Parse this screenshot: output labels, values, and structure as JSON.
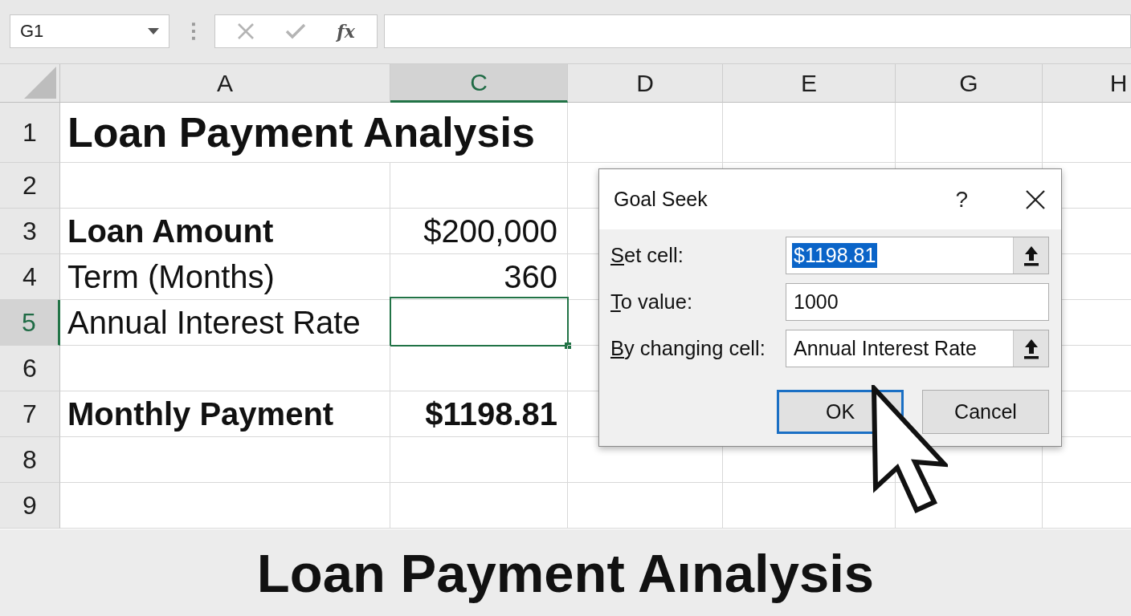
{
  "toolbar": {
    "name_box": {
      "value": "G1"
    },
    "function_button": "fx"
  },
  "sheet": {
    "columns": [
      {
        "label": "A",
        "selected": false
      },
      {
        "label": "C",
        "selected": true
      },
      {
        "label": "D",
        "selected": false
      },
      {
        "label": "E",
        "selected": false
      },
      {
        "label": "G",
        "selected": false
      },
      {
        "label": "H",
        "selected": false
      }
    ],
    "rows": [
      {
        "label": "1",
        "selected": false,
        "col_a": {
          "text": "Loan Payment Analysis",
          "bold": true
        }
      },
      {
        "label": "2",
        "selected": false
      },
      {
        "label": "3",
        "selected": false,
        "col_a": {
          "text": "Loan Amount",
          "bold": true
        },
        "col_c": {
          "text": "$200,000",
          "bold": false,
          "active": false
        }
      },
      {
        "label": "4",
        "selected": false,
        "col_a": {
          "text": "Term (Months)",
          "bold": false
        },
        "col_c": {
          "text": "360",
          "bold": false,
          "active": false
        }
      },
      {
        "label": "5",
        "selected": true,
        "col_a": {
          "text": "Annual Interest Rate",
          "bold": false
        },
        "col_c": {
          "active": true
        }
      },
      {
        "label": "6",
        "selected": false
      },
      {
        "label": "7",
        "selected": false,
        "col_a": {
          "text": "Monthly Payment",
          "bold": true
        },
        "col_c": {
          "text": "$1198.81",
          "bold": true,
          "active": false
        }
      },
      {
        "label": "8",
        "selected": false
      },
      {
        "label": "9",
        "selected": false
      }
    ]
  },
  "dialog": {
    "title": "Goal Seek",
    "help": "?",
    "fields": [
      {
        "label": "Set cell:",
        "value": "$1198.81",
        "kind": "reference",
        "text_selected": true
      },
      {
        "label": "To value:",
        "value": "1000",
        "kind": "value",
        "text_selected": false
      },
      {
        "label": "By changing cell:",
        "value": "Annual Interest Rate",
        "kind": "reference",
        "text_selected": false
      }
    ],
    "buttons": [
      {
        "label": "OK",
        "focused": true
      },
      {
        "label": "Cancel",
        "focused": false
      }
    ]
  },
  "caption": "Loan Payment Aınalysis"
}
